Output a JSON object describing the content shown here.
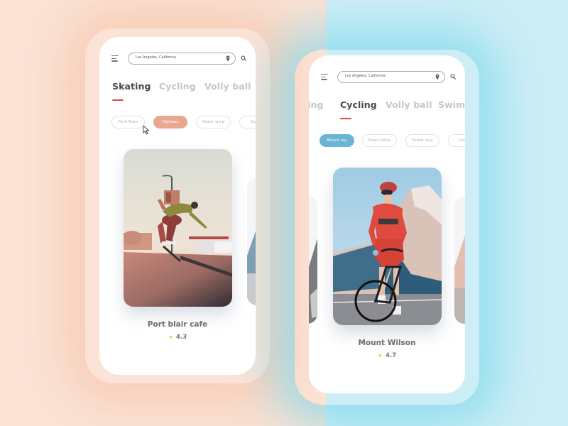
{
  "background": {
    "left_color": "#fbe3d6",
    "right_color": "#cdeef6"
  },
  "phones": [
    {
      "id": "skating",
      "search": {
        "value": "Los Angeles, California"
      },
      "icons": {
        "menu": "menu-icon",
        "pin": "location-pin-icon",
        "search": "search-icon"
      },
      "tabs": [
        {
          "label": "Skating",
          "active": true
        },
        {
          "label": "Cycling",
          "active": false
        },
        {
          "label": "Volly ball",
          "active": false
        }
      ],
      "chips": [
        {
          "label": "Park Town",
          "active": false
        },
        {
          "label": "Highway",
          "active": true
        },
        {
          "label": "Skate ramp",
          "active": false
        },
        {
          "label": "Sta",
          "active": false
        }
      ],
      "card": {
        "title": "Port blair cafe",
        "rating": "4.3",
        "image_subject": "skateboarder mid-air on a sunlit street"
      },
      "accent_color": "#e7a88e"
    },
    {
      "id": "cycling",
      "search": {
        "value": "Los Angeles, California"
      },
      "icons": {
        "menu": "menu-icon",
        "pin": "location-pin-icon",
        "search": "search-icon"
      },
      "tabs": [
        {
          "label": "ting",
          "active": false
        },
        {
          "label": "Cycling",
          "active": true
        },
        {
          "label": "Volly ball",
          "active": false
        },
        {
          "label": "Swimm",
          "active": false
        }
      ],
      "chips": [
        {
          "label": "Mount ray",
          "active": true
        },
        {
          "label": "River valley",
          "active": false
        },
        {
          "label": "Forest way",
          "active": false
        },
        {
          "label": "Lon",
          "active": false
        }
      ],
      "card": {
        "title": "Mount Wilson",
        "rating": "4.7",
        "image_subject": "cyclist in red kit with snowy mountain behind"
      },
      "accent_color": "#6ab5d6"
    }
  ],
  "tab_underline_color": "#e0483a",
  "star_color": "#f1c84b"
}
